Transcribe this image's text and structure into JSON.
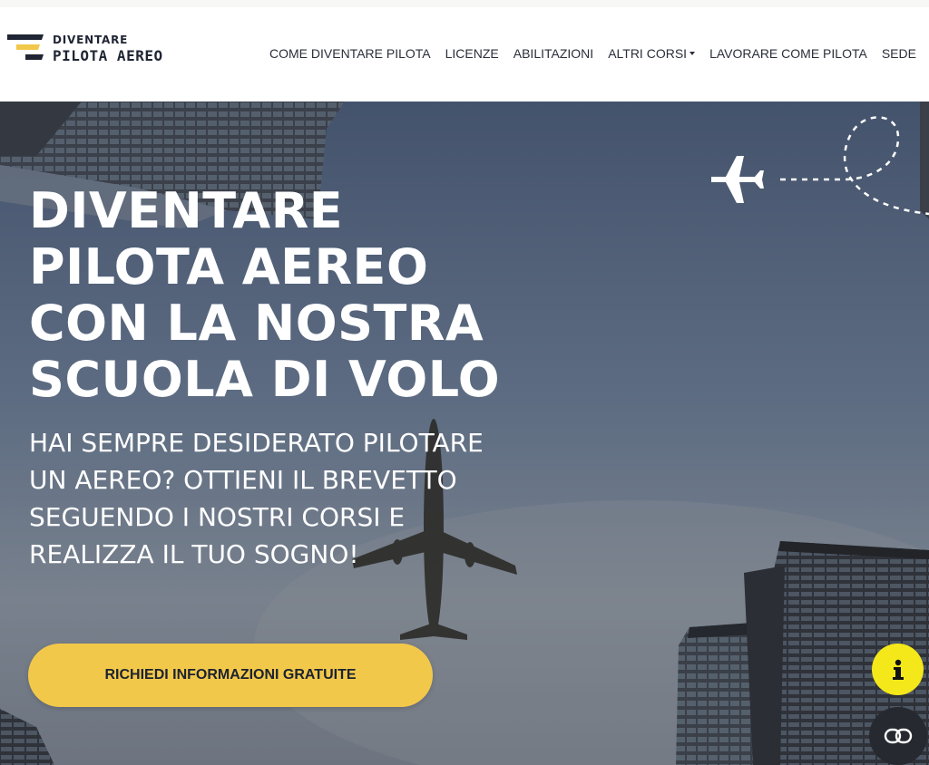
{
  "brand": {
    "line1": "DIVENTARE",
    "line2": "PILOTA AEREO",
    "accent_color": "#f2c84b",
    "dark_color": "#1f2533"
  },
  "nav": {
    "items": [
      {
        "label": "COME DIVENTARE PILOTA"
      },
      {
        "label": "LICENZE"
      },
      {
        "label": "ABILITAZIONI"
      },
      {
        "label": "ALTRI CORSI",
        "has_dropdown": true
      },
      {
        "label": "LAVORARE COME PILOTA"
      },
      {
        "label": "SEDE"
      }
    ]
  },
  "hero": {
    "title_lines": [
      "DIVENTARE",
      "PILOTA AEREO",
      "CON LA NOSTRA",
      "SCUOLA DI VOLO"
    ],
    "subtitle_lines": [
      "HAI SEMPRE DESIDERATO PILOTARE",
      "UN AEREO? OTTIENI IL BREVETTO",
      "SEGUENDO I NOSTRI CORSI E",
      "REALIZZA IL TUO SOGNO!"
    ],
    "cta_label": "RICHIEDI INFORMAZIONI GRATUITE",
    "cta_color": "#f2c84b"
  },
  "floating": {
    "info_icon": "info-icon",
    "info_color": "#f4e81a",
    "cookie_icon": "cookie-settings-icon",
    "cookie_color": "#262a30"
  }
}
